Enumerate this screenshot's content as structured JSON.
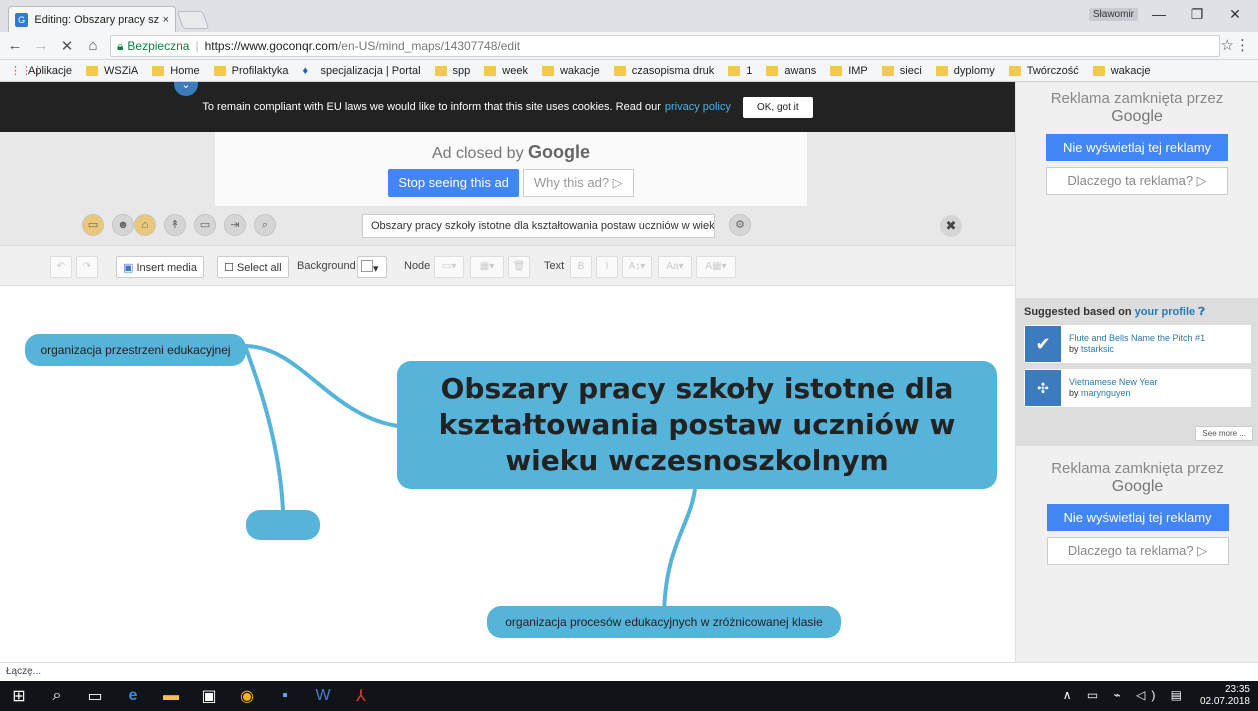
{
  "browser": {
    "tab_title": "Editing: Obszary pracy szk",
    "tab_close": "×",
    "user_name": "Sławomir",
    "secure_label": "Bezpieczna",
    "url_host": "https://www.goconqr.com",
    "url_path": "/en-US/mind_maps/14307748/edit",
    "bookmarks": [
      "Aplikacje",
      "WSZiA",
      "Home",
      "Profilaktyka",
      "specjalizacja | Portal",
      "spp",
      "week",
      "wakacje",
      "czasopisma druk",
      "1",
      "awans",
      "IMP",
      "sieci",
      "dyplomy",
      "Twórczość",
      "wakacje"
    ],
    "status_text": "Łączę..."
  },
  "cookie_bar": {
    "message": "To remain compliant with EU laws we would like to inform that this site uses cookies. Read our",
    "policy_link": "privacy policy",
    "ok_button": "OK, got it"
  },
  "top_ad": {
    "closed_by": "Ad closed by",
    "google": "Google",
    "stop_button": "Stop seeing this ad",
    "why_button": "Why this ad? ▷"
  },
  "toolbar": {
    "title_value": "Obszary pracy szkoły istotne dla kształtowania postaw uczniów w wieku",
    "insert_media": "Insert media",
    "select_all": "Select all",
    "background_label": "Background",
    "node_label": "Node",
    "text_label": "Text"
  },
  "mindmap": {
    "central_node": "Obszary pracy szkoły istotne dla kształtowania postaw uczniów w wieku wczesnoszkolnym",
    "nodes": [
      "organizacja przestrzeni edukacyjnej",
      "",
      "organizacja procesów edukacyjnych w zróżnicowanej klasie"
    ]
  },
  "sidebar": {
    "ad_closed_by": "Reklama zamknięta przez",
    "ad_google": "Google",
    "ad_stop": "Nie wyświetlaj tej reklamy",
    "ad_why": "Dlaczego ta reklama? ▷",
    "suggest_prefix": "Suggested based on",
    "suggest_link": "your profile",
    "cards": [
      {
        "title": "Flute and Bells Name the Pitch #1",
        "author_prefix": "by",
        "author": "tstarksic"
      },
      {
        "title": "Vietnamese New Year",
        "author_prefix": "by",
        "author": "marynguyen"
      }
    ],
    "see_more": "See more ..."
  },
  "taskbar": {
    "time": "23:35",
    "date": "02.07.2018"
  }
}
